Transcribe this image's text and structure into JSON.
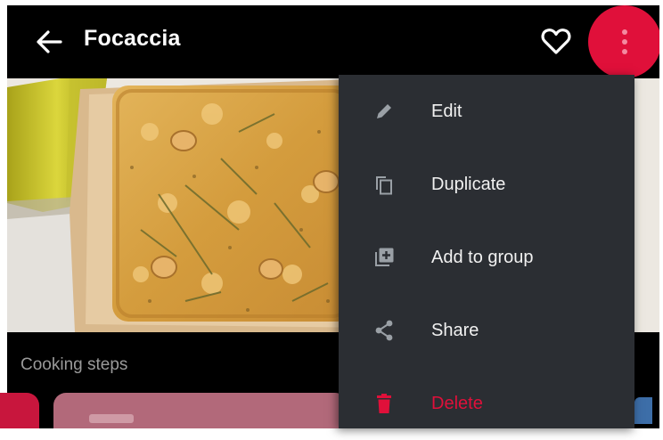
{
  "appbar": {
    "title": "Focaccia",
    "back_icon": "arrow-back-icon",
    "favorite_icon": "heart-outline-icon",
    "more_icon": "more-vert-icon",
    "accent_color": "#e0103a"
  },
  "section": {
    "cooking_steps_label": "Cooking steps"
  },
  "menu": {
    "items": [
      {
        "label": "Edit",
        "icon": "pencil-icon"
      },
      {
        "label": "Duplicate",
        "icon": "copy-icon"
      },
      {
        "label": "Add to group",
        "icon": "add-to-group-icon"
      },
      {
        "label": "Share",
        "icon": "share-icon"
      },
      {
        "label": "Delete",
        "icon": "trash-icon",
        "color": "#e0103a"
      }
    ]
  }
}
